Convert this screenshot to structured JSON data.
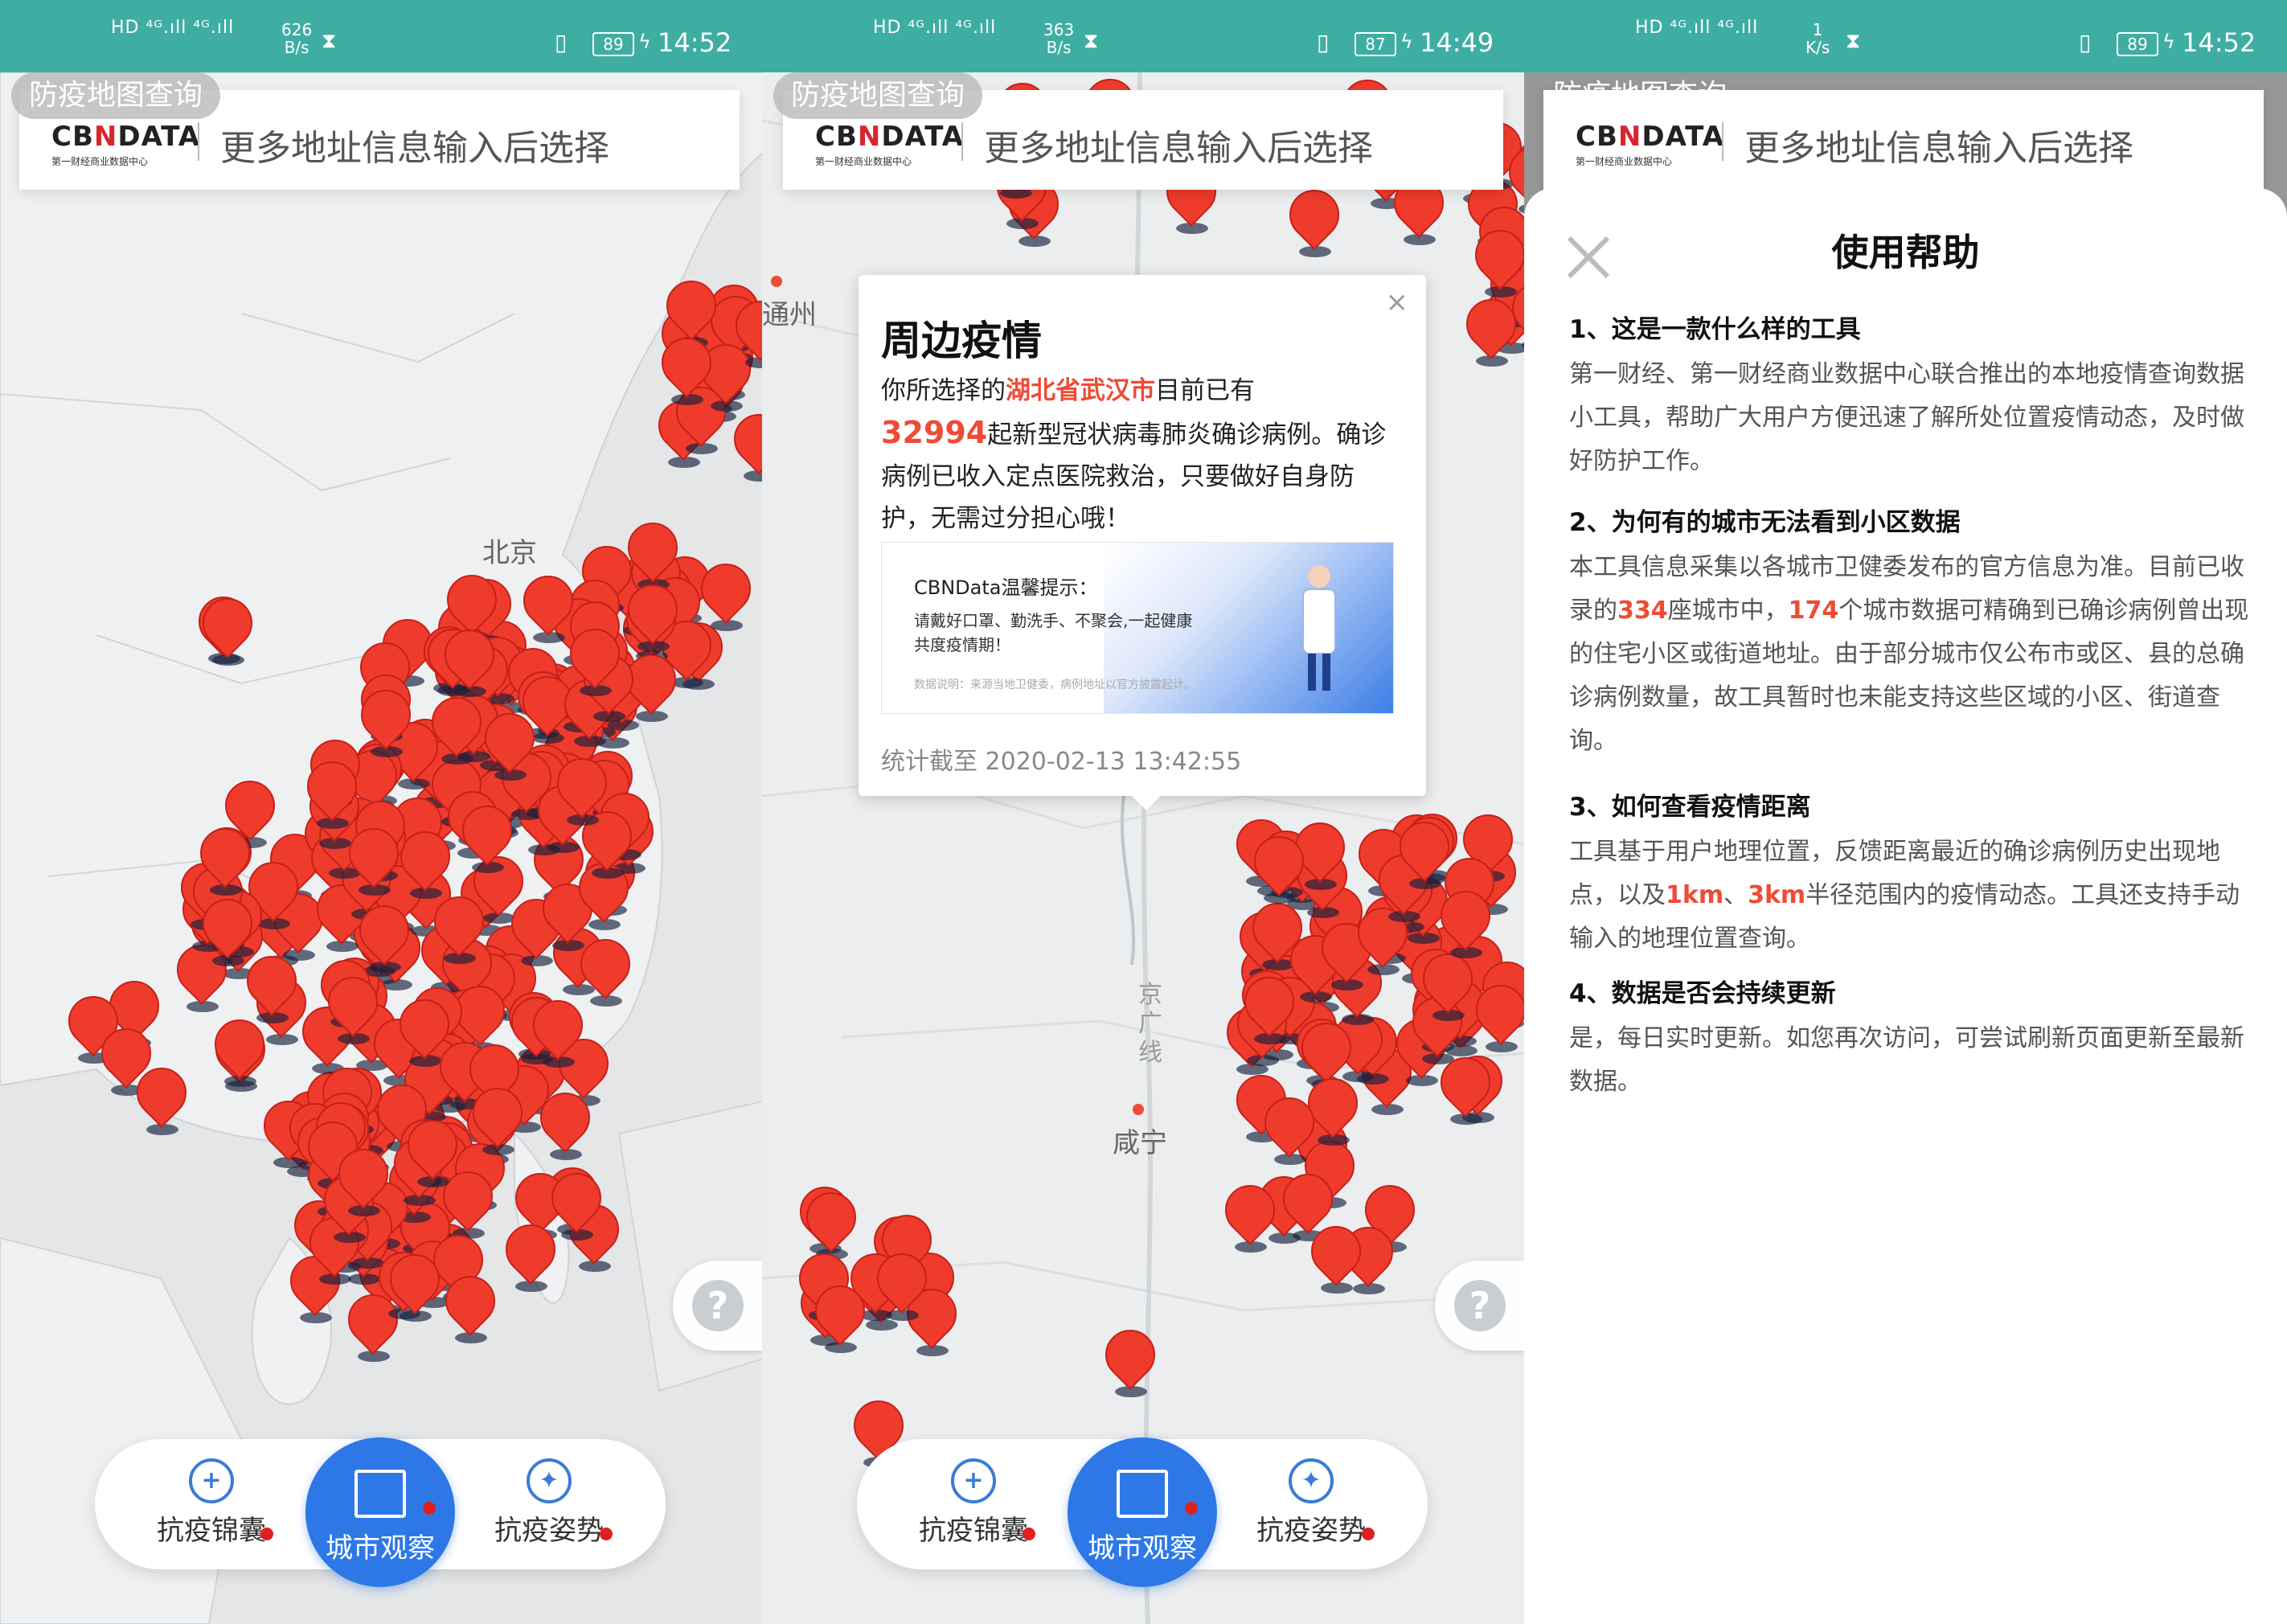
{
  "status_bars": [
    {
      "left": "HD ⁴ᴳ.ıll ⁴ᴳ.ıll",
      "speed": "626\nB/s",
      "battery": "89",
      "time": "14:52"
    },
    {
      "left": "HD ⁴ᴳ.ıll ⁴ᴳ.ıll",
      "speed": "363\nB/s",
      "battery": "87",
      "time": "14:49"
    },
    {
      "left": "HD ⁴ᴳ.ıll ⁴ᴳ.ıll",
      "speed": "1\nK/s",
      "battery": "89",
      "time": "14:52"
    }
  ],
  "chip": "防疫地图查询",
  "search": {
    "logo_main_a": "CB",
    "logo_main_x": "N",
    "logo_main_b": "DATA",
    "logo_sub": "第一财经商业数据中心",
    "placeholder": "更多地址信息输入后选择"
  },
  "map_labels": {
    "beijing": "北京",
    "tongzhou": "通州",
    "xianning": "咸宁",
    "railway": "京广线"
  },
  "popup": {
    "title": "周边疫情",
    "line1_pre": "你所选择的",
    "location": "湖北省武汉市",
    "line1_post": "目前已有",
    "count": "32994",
    "line2": "起新型冠状病毒肺炎确诊病例。确诊病例已收入定点医院救治，只要做好自身防护，无需过分担心哦！",
    "tip_title": "CBNData温馨提示：",
    "tip_body": "请戴好口罩、勤洗手、不聚会,一起健康共度疫情期！",
    "tip_note": "数据说明：来源当地卫健委，病例地址以官方披露起计。",
    "stamp": "统计截至 2020-02-13 13:42:55",
    "close": "×"
  },
  "nav": {
    "left": "抗疫锦囊",
    "center": "城市观察",
    "right": "抗疫姿势",
    "icons": [
      "bag-icon",
      "building-icon",
      "pushpin-icon"
    ]
  },
  "help": {
    "title": "使用帮助",
    "s1_title": "1、这是一款什么样的工具",
    "s1_body": "第一财经、第一财经商业数据中心联合推出的本地疫情查询数据小工具，帮助广大用户方便迅速了解所处位置疫情动态，及时做好防护工作。",
    "s2_title": "2、为何有的城市无法看到小区数据",
    "s2_a": "本工具信息采集以各城市卫健委发布的官方信息为准。目前已收录的",
    "s2_n1": "334",
    "s2_b": "座城市中，",
    "s2_n2": "174",
    "s2_c": "个城市数据可精确到已确诊病例曾出现的住宅小区或街道地址。由于部分城市仅公布市或区、县的总确诊病例数量，故工具暂时也未能支持这些区域的小区、街道查询。",
    "s3_title": "3、如何查看疫情距离",
    "s3_a": "工具基于用户地理位置，反馈距离最近的确诊病例历史出现地点，以及",
    "s3_n1": "1km",
    "s3_sep": "、",
    "s3_n2": "3km",
    "s3_b": "半径范围内的疫情动态。工具还支持手动输入的地理位置查询。",
    "s4_title": "4、数据是否会持续更新",
    "s4_body": "是，每日实时更新。如您再次访问，可尝试刷新页面更新至最新数据。"
  },
  "colors": {
    "statusbar": "#3eaea3",
    "pin": "#ef3b2c",
    "accent_blue": "#2d78e6",
    "highlight": "#ef4b35"
  },
  "help_fab": "?"
}
